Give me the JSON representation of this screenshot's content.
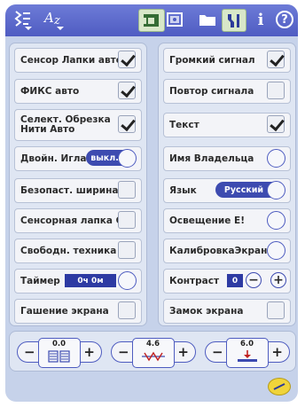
{
  "toolbar": {
    "items": [
      {
        "name": "stitch-menu-icon"
      },
      {
        "name": "alphabet-icon"
      },
      {
        "name": "sewing-mode-icon"
      },
      {
        "name": "embroidery-mode-icon"
      },
      {
        "name": "folder-icon"
      },
      {
        "name": "setup-menu-icon",
        "active": true
      },
      {
        "name": "info-icon",
        "text": "i"
      },
      {
        "name": "help-icon",
        "text": "?"
      }
    ]
  },
  "left_panel": {
    "rows": [
      {
        "label": "Сенсор Лапки авто",
        "control": "checkbox",
        "checked": true
      },
      {
        "label": "ФИКС авто",
        "control": "checkbox",
        "checked": true
      },
      {
        "label": "Селект. Обрезка Нити Авто",
        "control": "checkbox",
        "checked": true
      },
      {
        "label": "Двойн. Игла",
        "control": "toggle",
        "value": "выкл."
      },
      {
        "label": "Безопаст. ширина",
        "control": "checkbox",
        "checked": false
      },
      {
        "label": "Сенсорная лапка Q",
        "control": "checkbox",
        "checked": false
      },
      {
        "label": "Свободн. техника",
        "control": "checkbox",
        "checked": false
      },
      {
        "label": "Таймер",
        "control": "value",
        "value": "0ч 0м"
      },
      {
        "label": "Гашение экрана",
        "control": "checkbox",
        "checked": false
      }
    ]
  },
  "right_panel": {
    "rows": [
      {
        "label": "Громкий сигнал",
        "control": "checkbox",
        "checked": true
      },
      {
        "label": "Повтор сигнала",
        "control": "checkbox",
        "checked": false
      },
      {
        "label": "Текст",
        "control": "checkbox",
        "checked": true
      },
      {
        "label": "Имя Владельца",
        "control": "radio"
      },
      {
        "label": "Язык",
        "control": "toggle",
        "value": "Русский"
      },
      {
        "label": "Освещение E!",
        "control": "radio"
      },
      {
        "label": "КалибровкаЭкрана",
        "control": "radio"
      },
      {
        "label": "Контраст",
        "control": "stepper",
        "value": "0",
        "minus": "−",
        "plus": "+"
      },
      {
        "label": "Замок экрана",
        "control": "checkbox",
        "checked": false
      }
    ]
  },
  "steppers": [
    {
      "name": "feed-dog-balance",
      "value": "0.0",
      "minus": "−",
      "plus": "+",
      "icon": "feed-dog-icon"
    },
    {
      "name": "stitch-balance",
      "value": "4.6",
      "minus": "−",
      "plus": "+",
      "icon": "zigzag-stitch-icon"
    },
    {
      "name": "presser-foot-height",
      "value": "6.0",
      "minus": "−",
      "plus": "+",
      "icon": "presser-foot-icon"
    }
  ],
  "colors": {
    "toolbar": "#5664c8",
    "accent": "#3d4bb0",
    "background": "#c6d2ea",
    "confirm": "#f0d43a"
  }
}
